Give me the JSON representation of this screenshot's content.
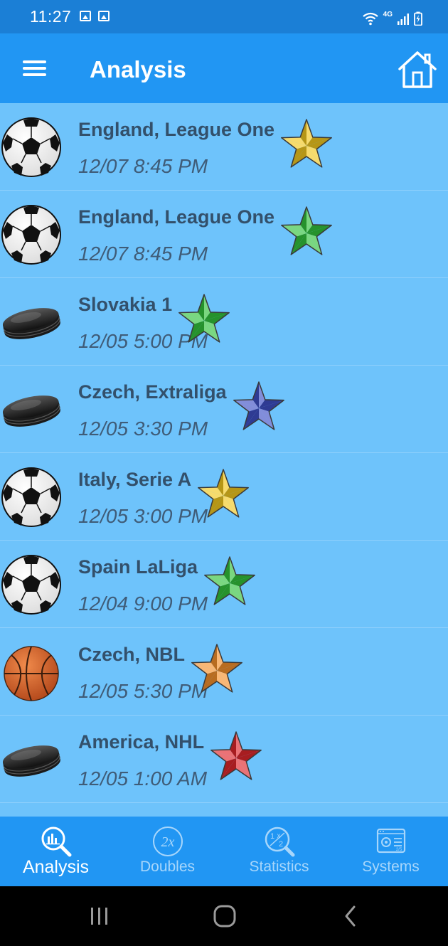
{
  "status_bar": {
    "time": "11:27",
    "network": "4G"
  },
  "app_bar": {
    "title": "Analysis"
  },
  "matches": [
    {
      "sport": "soccer",
      "league": "England, League One",
      "datetime": "12/07 8:45 PM",
      "star_color": "#f2c81d"
    },
    {
      "sport": "soccer",
      "league": "England, League One",
      "datetime": "12/07 8:45 PM",
      "star_color": "#33c23b"
    },
    {
      "sport": "hockey",
      "league": "Slovakia 1",
      "datetime": "12/05 5:00 PM",
      "star_color": "#33c23b"
    },
    {
      "sport": "hockey",
      "league": "Czech, Extraliga",
      "datetime": "12/05 3:30 PM",
      "star_color": "#3e4fc4"
    },
    {
      "sport": "soccer",
      "league": "Italy, Serie A",
      "datetime": "12/05 3:00 PM",
      "star_color": "#f2c81d"
    },
    {
      "sport": "soccer",
      "league": "Spain LaLiga",
      "datetime": "12/04 9:00 PM",
      "star_color": "#33c23b"
    },
    {
      "sport": "basketball",
      "league": "Czech, NBL",
      "datetime": "12/05 5:30 PM",
      "star_color": "#f5902a"
    },
    {
      "sport": "hockey",
      "league": "America, NHL",
      "datetime": "12/05 1:00 AM",
      "star_color": "#e0262b"
    }
  ],
  "bottom_nav": [
    {
      "label": "Analysis",
      "icon": "analysis-icon",
      "active": true
    },
    {
      "label": "Doubles",
      "icon": "doubles-2x-icon",
      "active": false
    },
    {
      "label": "Statistics",
      "icon": "statistics-icon",
      "active": false
    },
    {
      "label": "Systems",
      "icon": "systems-icon",
      "active": false
    }
  ],
  "colors": {
    "status_bar": "#1b7fd6",
    "app_bar": "#2196f3",
    "list_background": "#6ec3fb",
    "text_primary": "#33506b",
    "nav_active": "#ffffff",
    "nav_inactive": "#a7d6fb"
  }
}
